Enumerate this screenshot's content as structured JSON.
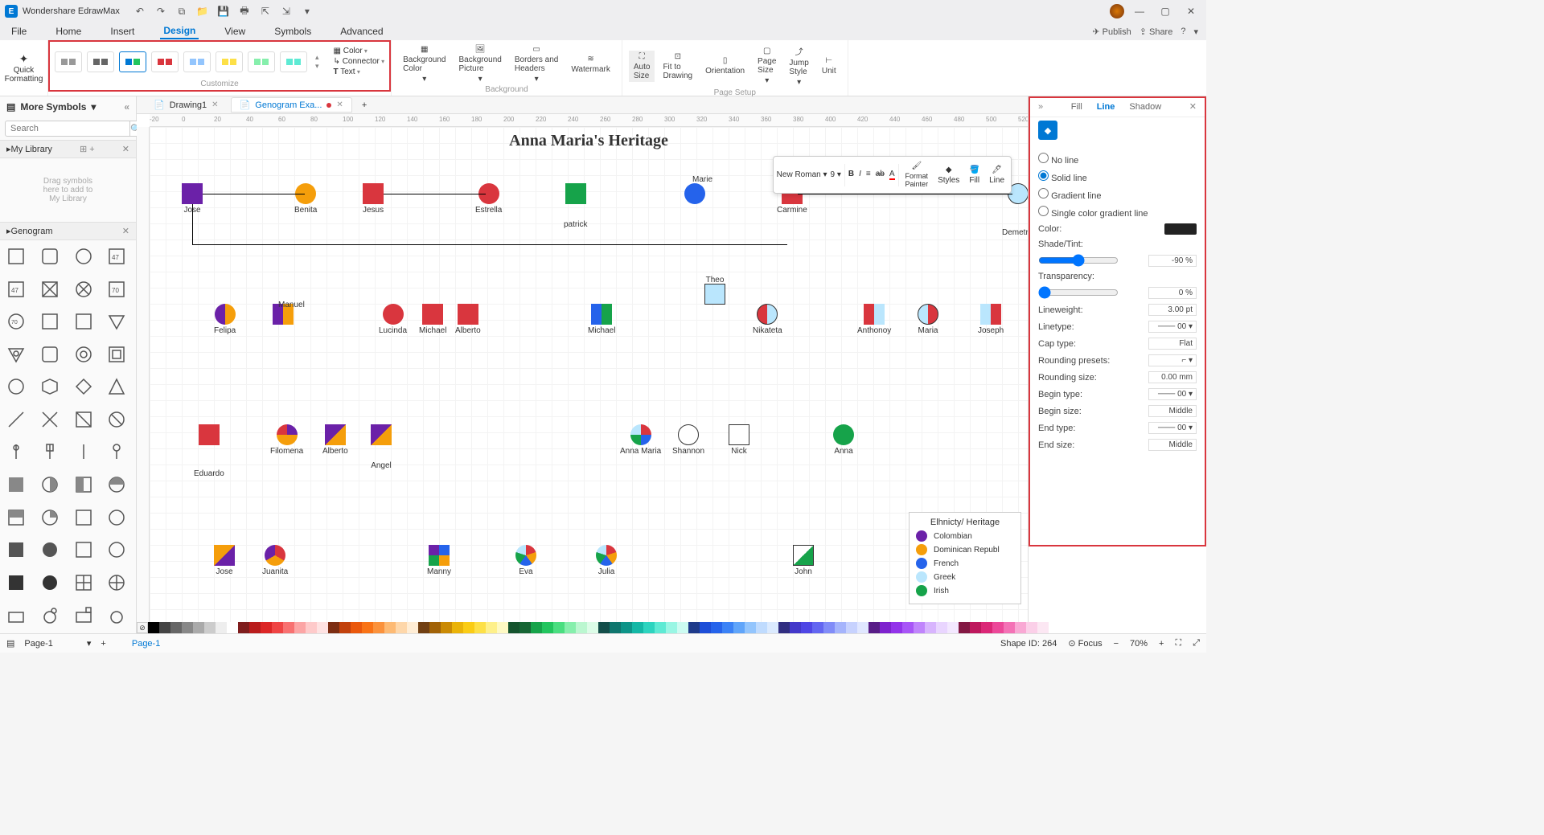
{
  "app": {
    "title": "Wondershare EdrawMax"
  },
  "menubar": {
    "items": [
      "File",
      "Home",
      "Insert",
      "Design",
      "View",
      "Symbols",
      "Advanced"
    ],
    "active": "Design",
    "publish": "Publish",
    "share": "Share"
  },
  "ribbon": {
    "quick": "Quick\nFormatting",
    "customize_label": "Customize",
    "color": "Color",
    "connector": "Connector",
    "text": "Text",
    "bgcolor": "Background\nColor",
    "bgpic": "Background\nPicture",
    "borders": "Borders and\nHeaders",
    "watermark": "Watermark",
    "bg_label": "Background",
    "autosize": "Auto\nSize",
    "fit": "Fit to\nDrawing",
    "orient": "Orientation",
    "pagesize": "Page\nSize",
    "jump": "Jump\nStyle",
    "unit": "Unit",
    "page_setup": "Page Setup"
  },
  "left": {
    "more": "More Symbols",
    "search_ph": "Search",
    "mylib": "My Library",
    "drop": "Drag symbols\nhere to add to\nMy Library",
    "genogram": "Genogram"
  },
  "tabs": {
    "t1": "Drawing1",
    "t2": "Genogram Exa..."
  },
  "canvas": {
    "title": "Anna Maria's Heritage",
    "people": {
      "jose": "Jose",
      "benita": "Benita",
      "jesus": "Jesus",
      "estrella": "Estrella",
      "patrick": "patrick",
      "marie": "Marie",
      "carmine": "Carmine",
      "demetria": "Demetria",
      "felipa": "Felipa",
      "manuel": "Manuel",
      "lucinda": "Lucinda",
      "michael": "Michael",
      "alberto": "Alberto",
      "michael2": "Michael",
      "theo": "Theo",
      "nikateta": "Nikateta",
      "anthonoy": "Anthonoy",
      "maria": "Maria",
      "joseph": "Joseph",
      "eduardo": "Eduardo",
      "filomena": "Filomena",
      "alberto2": "Alberto",
      "angel": "Angel",
      "annamaria": "Anna Maria",
      "shannon": "Shannon",
      "nick": "Nick",
      "anna": "Anna",
      "jose2": "Jose",
      "juanita": "Juanita",
      "manny": "Manny",
      "eva": "Eva",
      "julia": "Julia",
      "john": "John"
    }
  },
  "float": {
    "font": "New Roman",
    "size": "9",
    "fmt": "Format\nPainter",
    "styles": "Styles",
    "fill": "Fill",
    "line": "Line"
  },
  "rp": {
    "fill": "Fill",
    "line": "Line",
    "shadow": "Shadow",
    "no_line": "No line",
    "solid": "Solid line",
    "grad": "Gradient line",
    "sgrad": "Single color gradient line",
    "color": "Color:",
    "shade": "Shade/Tint:",
    "shade_v": "-90 %",
    "transp": "Transparency:",
    "transp_v": "0 %",
    "lw": "Lineweight:",
    "lw_v": "3.00 pt",
    "lt": "Linetype:",
    "lt_v": "00",
    "cap": "Cap type:",
    "cap_v": "Flat",
    "rp_": "Rounding presets:",
    "rs": "Rounding size:",
    "rs_v": "0.00 mm",
    "bt": "Begin type:",
    "bt_v": "00",
    "bs": "Begin size:",
    "bs_v": "Middle",
    "et": "End type:",
    "et_v": "00",
    "es": "End size:",
    "es_v": "Middle"
  },
  "legend": {
    "title": "Elhnicty/ Heritage",
    "items": [
      {
        "c": "#6b21a8",
        "t": "Colombian"
      },
      {
        "c": "#f59e0b",
        "t": "Dominican Republ"
      },
      {
        "c": "#2563eb",
        "t": "French"
      },
      {
        "c": "#bae6fd",
        "t": "Greek"
      },
      {
        "c": "#16a34a",
        "t": "Irish"
      }
    ]
  },
  "status": {
    "page": "Page-1",
    "page_tab": "Page-1",
    "shape": "Shape ID: 264",
    "focus": "Focus",
    "zoom": "70%"
  },
  "ruler_ticks": [
    "-20",
    "0",
    "20",
    "40",
    "60",
    "80",
    "100",
    "120",
    "140",
    "160",
    "180",
    "200",
    "220",
    "240",
    "260",
    "280",
    "300",
    "320",
    "340",
    "360",
    "380",
    "400",
    "420",
    "440",
    "460",
    "480",
    "500",
    "520"
  ]
}
